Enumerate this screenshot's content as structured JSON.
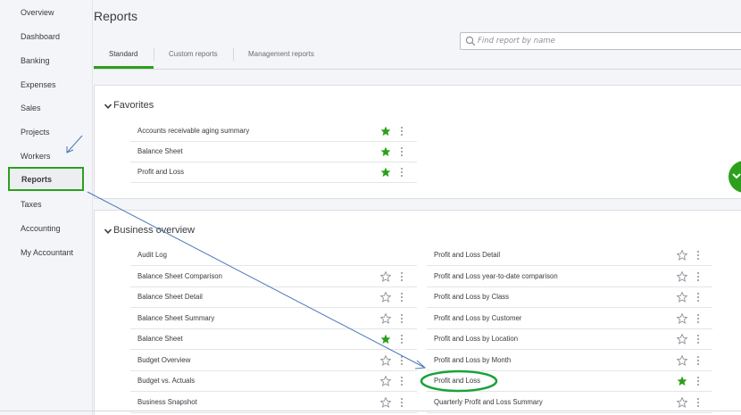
{
  "sidebar": {
    "items": [
      {
        "label": "Overview"
      },
      {
        "label": "Dashboard"
      },
      {
        "label": "Banking"
      },
      {
        "label": "Expenses"
      },
      {
        "label": "Sales"
      },
      {
        "label": "Projects"
      },
      {
        "label": "Workers"
      },
      {
        "label": "Reports",
        "active": true
      },
      {
        "label": "Taxes"
      },
      {
        "label": "Accounting"
      },
      {
        "label": "My Accountant"
      }
    ]
  },
  "header": {
    "title": "Reports",
    "search_placeholder": "Find report by name"
  },
  "tabs": [
    {
      "label": "Standard",
      "active": true
    },
    {
      "label": "Custom reports"
    },
    {
      "label": "Management reports"
    }
  ],
  "favorites": {
    "title": "Favorites",
    "rows": [
      {
        "label": "Accounts receivable aging summary",
        "starred": true
      },
      {
        "label": "Balance Sheet",
        "starred": true
      },
      {
        "label": "Profit and Loss",
        "starred": true
      }
    ]
  },
  "business_overview": {
    "title": "Business overview",
    "left": [
      {
        "label": "Audit Log",
        "starred": null
      },
      {
        "label": "Balance Sheet Comparison",
        "starred": false
      },
      {
        "label": "Balance Sheet Detail",
        "starred": false
      },
      {
        "label": "Balance Sheet Summary",
        "starred": false
      },
      {
        "label": "Balance Sheet",
        "starred": true
      },
      {
        "label": "Budget Overview",
        "starred": false
      },
      {
        "label": "Budget vs. Actuals",
        "starred": false
      },
      {
        "label": "Business Snapshot",
        "starred": false
      }
    ],
    "right": [
      {
        "label": "Profit and Loss Detail",
        "starred": false
      },
      {
        "label": "Profit and Loss year-to-date comparison",
        "starred": false
      },
      {
        "label": "Profit and Loss by Class",
        "starred": false
      },
      {
        "label": "Profit and Loss by Customer",
        "starred": false
      },
      {
        "label": "Profit and Loss by Location",
        "starred": false
      },
      {
        "label": "Profit and Loss by Month",
        "starred": false
      },
      {
        "label": "Profit and Loss",
        "starred": true
      },
      {
        "label": "Quarterly Profit and Loss Summary",
        "starred": false
      }
    ]
  },
  "colors": {
    "accent": "#2ca01c",
    "annotation_blue": "#4a78b8",
    "annotation_green": "#1aa13a"
  }
}
